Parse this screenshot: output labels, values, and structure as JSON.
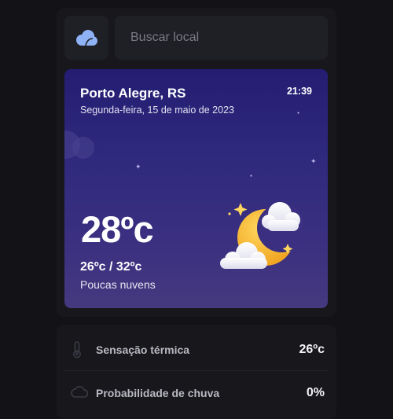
{
  "search": {
    "placeholder": "Buscar local",
    "logo_icon": "cloud-logo-icon"
  },
  "weather": {
    "city": "Porto Alegre, RS",
    "date": "Segunda-feira, 15 de maio de 2023",
    "time": "21:39",
    "temperature": "28ºc",
    "range": "26ºc / 32ºc",
    "description": "Poucas nuvens",
    "icon": "moon-clouds-icon"
  },
  "details": [
    {
      "label": "Sensação térmica",
      "value": "26ºc",
      "icon": "thermometer-icon"
    },
    {
      "label": "Probabilidade de chuva",
      "value": "0%",
      "icon": "cloud-rain-icon"
    }
  ],
  "colors": {
    "background": "#131317",
    "panel": "#17171c",
    "input": "#1f1f26",
    "logo": "#8fb2f5",
    "card_top": "#241d72",
    "card_bottom": "#45397f",
    "moon": "#f7b432"
  }
}
